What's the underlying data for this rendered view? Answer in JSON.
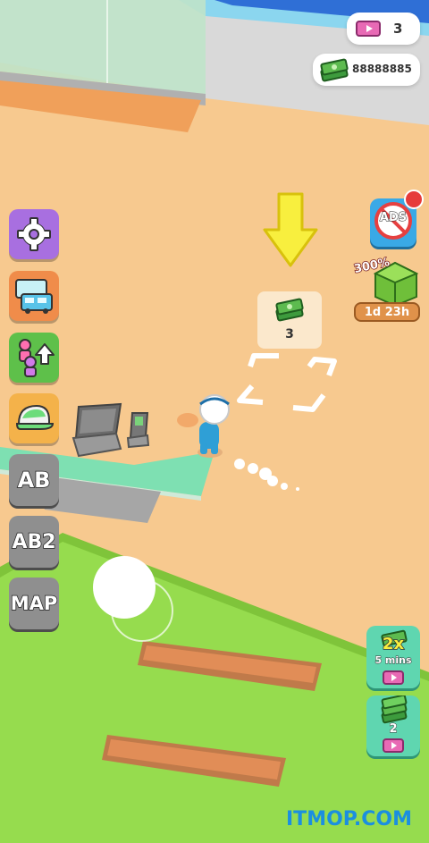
{
  "hud": {
    "tickets_count": "3",
    "cash_amount": "88888885"
  },
  "left_menu": {
    "ab_label": "AB",
    "ab2_label": "AB2",
    "map_label": "MAP"
  },
  "right_menu": {
    "ads_label": "ADS",
    "offer_percent": "300%",
    "offer_timer": "1d 23h",
    "boost_multiplier": "2x",
    "boost_duration": "5 mins",
    "cash_pack_count": "2"
  },
  "world": {
    "cash_pickup_count": "3"
  },
  "watermark": "ITMOP.COM",
  "colors": {
    "floor": "#f7c98f",
    "grass": "#96dc4e",
    "counter": "#7ee0b2",
    "arrow": "#f8ef3e"
  }
}
